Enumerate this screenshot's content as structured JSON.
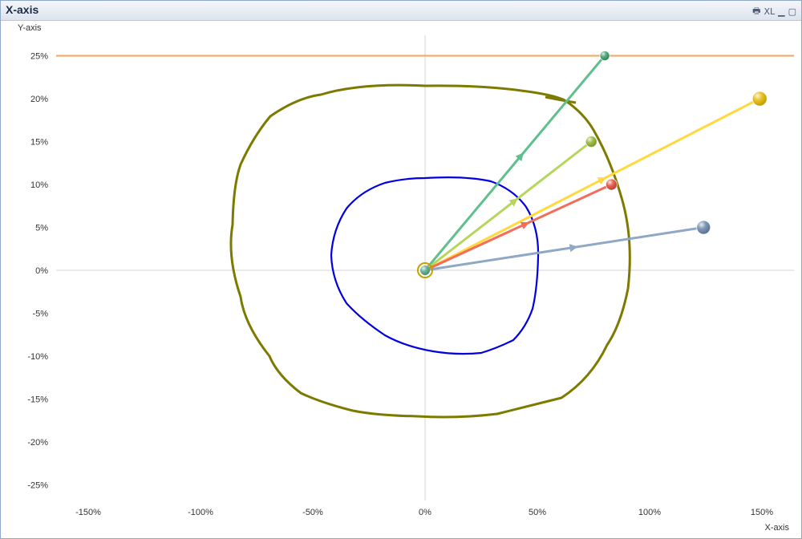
{
  "window": {
    "title": "X-axis",
    "icons": [
      {
        "name": "print-icon",
        "glyph": "🖶"
      },
      {
        "name": "excel-export-icon",
        "glyph": "XL"
      },
      {
        "name": "minimize-icon",
        "glyph": "▁"
      },
      {
        "name": "maximize-icon",
        "glyph": "▢"
      }
    ]
  },
  "chart_data": {
    "type": "scatter",
    "xlabel": "X-axis",
    "ylabel": "Y-axis",
    "xlim": [
      -165,
      165
    ],
    "ylim": [
      -27.5,
      27.5
    ],
    "x_ticks": [
      -150,
      -100,
      -50,
      0,
      50,
      100,
      150
    ],
    "y_ticks": [
      25,
      20,
      15,
      10,
      5,
      0,
      -5,
      -10,
      -15,
      -20,
      -25
    ],
    "tick_format": "percent",
    "grid": "zero-lines-only",
    "reference_line": {
      "y": 25,
      "color": "#f5a55a"
    },
    "origin": {
      "x": 0,
      "y": 0
    },
    "series": [
      {
        "x": 80,
        "y": 25,
        "color": "#5fbf8e",
        "ball": "#3a9a6a",
        "r": 6
      },
      {
        "x": 149,
        "y": 20,
        "color": "#ffd93d",
        "ball": "#e5b800",
        "r": 9
      },
      {
        "x": 74,
        "y": 15,
        "color": "#b5d65a",
        "ball": "#8fb52e",
        "r": 7
      },
      {
        "x": 83,
        "y": 10,
        "color": "#f26e5a",
        "ball": "#e04a3a",
        "r": 7
      },
      {
        "x": 124,
        "y": 5,
        "color": "#8ea8c6",
        "ball": "#6a86aa",
        "r": 8.5
      }
    ],
    "annotations": {
      "outer_loop_color": "#7d7a00",
      "inner_loop_color": "#0000e0"
    }
  }
}
